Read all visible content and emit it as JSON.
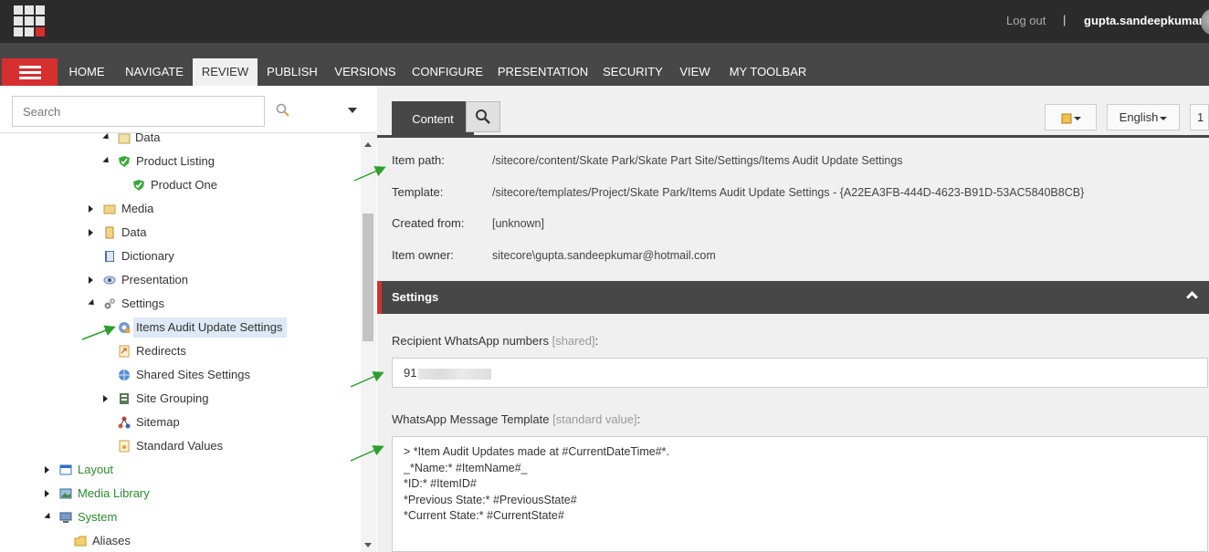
{
  "header": {
    "logout_label": "Log out",
    "separator": "|",
    "username": "gupta.sandeepkumar"
  },
  "ribbon": {
    "tabs": [
      "HOME",
      "NAVIGATE",
      "REVIEW",
      "PUBLISH",
      "VERSIONS",
      "CONFIGURE",
      "PRESENTATION",
      "SECURITY",
      "VIEW",
      "MY TOOLBAR"
    ],
    "active_tab": "REVIEW"
  },
  "search": {
    "placeholder": "Search"
  },
  "tree": {
    "items": [
      {
        "label": "Data",
        "icon": "folder-data-icon"
      },
      {
        "label": "Product Listing",
        "icon": "shield-check-icon"
      },
      {
        "label": "Product One",
        "icon": "shield-check-icon"
      },
      {
        "label": "Media",
        "icon": "media-folder-icon"
      },
      {
        "label": "Data",
        "icon": "data-icon"
      },
      {
        "label": "Dictionary",
        "icon": "dictionary-icon"
      },
      {
        "label": "Presentation",
        "icon": "eye-icon"
      },
      {
        "label": "Settings",
        "icon": "gears-icon"
      },
      {
        "label": "Items Audit Update Settings",
        "icon": "settings-item-icon",
        "selected": true
      },
      {
        "label": "Redirects",
        "icon": "redirect-icon"
      },
      {
        "label": "Shared Sites Settings",
        "icon": "globe-icon"
      },
      {
        "label": "Site Grouping",
        "icon": "grouping-icon"
      },
      {
        "label": "Sitemap",
        "icon": "sitemap-icon"
      },
      {
        "label": "Standard Values",
        "icon": "standard-values-icon"
      },
      {
        "label": "Layout",
        "icon": "layout-icon"
      },
      {
        "label": "Media Library",
        "icon": "media-library-icon"
      },
      {
        "label": "System",
        "icon": "system-icon"
      },
      {
        "label": "Aliases",
        "icon": "folder-icon"
      }
    ]
  },
  "editor": {
    "content_tab": "Content",
    "language": "English",
    "version_label": "1",
    "info": {
      "item_path_label": "Item path:",
      "item_path": "/sitecore/content/Skate Park/Skate Part Site/Settings/Items Audit Update Settings",
      "template_label": "Template:",
      "template": "/sitecore/templates/Project/Skate Park/Items Audit Update Settings - {A22EA3FB-444D-4623-B91D-53AC5840B8CB}",
      "created_from_label": "Created from:",
      "created_from": "[unknown]",
      "item_owner_label": "Item owner:",
      "item_owner": "sitecore\\gupta.sandeepkumar@hotmail.com"
    },
    "section_title": "Settings",
    "field1_label": "Recipient WhatsApp numbers",
    "field1_qualifier": "[shared]",
    "field1_suffix": ":",
    "field1_value": "91",
    "field2_label": "WhatsApp Message Template",
    "field2_qualifier": "[standard value]",
    "field2_suffix": ":",
    "field2_lines": [
      "> *Item Audit Updates made at #CurrentDateTime#*.",
      "_*Name:* #ItemName#_",
      "*ID:* #ItemID#",
      "*Previous State:* #PreviousState#",
      "*Current State:* #CurrentState#"
    ]
  },
  "colors": {
    "accent_red": "#d62f2f",
    "dark_bar": "#2b2b2b",
    "ribbon_bar": "#474747",
    "annotation_green": "#2e9e2e"
  }
}
